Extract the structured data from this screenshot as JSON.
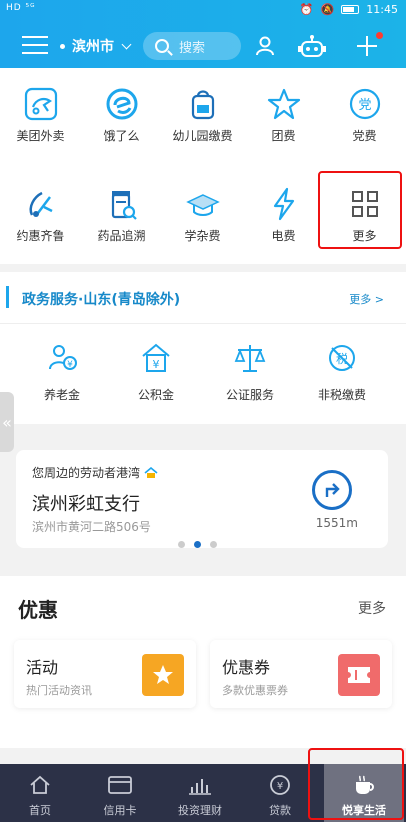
{
  "status": {
    "left": "HD ⁵ᴳ",
    "time": "11:45"
  },
  "header": {
    "city": "滨州市",
    "search_placeholder": "搜索"
  },
  "grid_row1": [
    {
      "label": "美团外卖",
      "icon": "meituan-icon"
    },
    {
      "label": "饿了么",
      "icon": "eleme-icon"
    },
    {
      "label": "幼儿园缴费",
      "icon": "kindergarten-icon"
    },
    {
      "label": "团费",
      "icon": "star-icon"
    },
    {
      "label": "党费",
      "icon": "party-icon"
    }
  ],
  "grid_row2": [
    {
      "label": "约惠齐鲁",
      "icon": "music-icon"
    },
    {
      "label": "药品追溯",
      "icon": "medicine-icon"
    },
    {
      "label": "学杂费",
      "icon": "graduation-cap-icon"
    },
    {
      "label": "电费",
      "icon": "lightning-icon"
    },
    {
      "label": "更多",
      "icon": "grid-icon"
    }
  ],
  "gov": {
    "title": "政务服务·山东(青岛除外)",
    "more": "更多 >",
    "items": [
      {
        "label": "养老金",
        "icon": "pension-icon"
      },
      {
        "label": "公积金",
        "icon": "housing-fund-icon"
      },
      {
        "label": "公证服务",
        "icon": "scale-icon"
      },
      {
        "label": "非税缴费",
        "icon": "tax-icon"
      }
    ]
  },
  "outlet": {
    "subtitle": "您周边的劳动者港湾",
    "name": "滨州彩虹支行",
    "address": "滨州市黄河二路506号",
    "distance": "1551m"
  },
  "promo": {
    "title": "优惠",
    "more": "更多",
    "cards": [
      {
        "title": "活动",
        "subtitle": "热门活动资讯"
      },
      {
        "title": "优惠券",
        "subtitle": "多款优惠票券"
      }
    ]
  },
  "bottom_nav": [
    {
      "label": "首页"
    },
    {
      "label": "信用卡"
    },
    {
      "label": "投资理财"
    },
    {
      "label": "贷款"
    },
    {
      "label": "悦享生活"
    }
  ],
  "colors": {
    "brand": "#1da6ec",
    "nav_bg": "#2c3147",
    "highlight": "#ee1111"
  }
}
